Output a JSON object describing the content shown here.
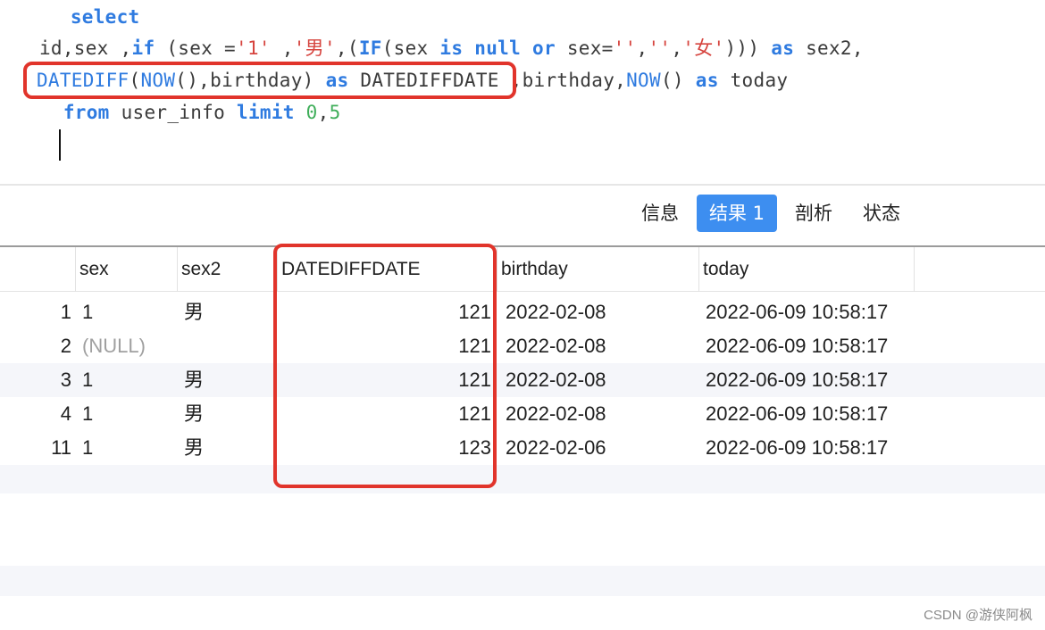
{
  "editor": {
    "line1": {
      "indent": "   ",
      "kw_select": "select"
    },
    "line2": {
      "t1": " id,sex ,",
      "kw_if": "if",
      "t2": " (sex =",
      "s1": "'1'",
      "t3": " ,",
      "s2": "'男'",
      "t4": ",(",
      "kw_IF": "IF",
      "t5": "(sex ",
      "kw_is": "is",
      "t6": " ",
      "kw_null": "null",
      "t7": " ",
      "kw_or": "or",
      "t8": " sex=",
      "s3": "''",
      "t9": ",",
      "s4": "''",
      "t10": ",",
      "s5": "'女'",
      "t11": "))) ",
      "kw_as": "as",
      "t12": " sex2,"
    },
    "line3": {
      "t0": " ",
      "fn_datediff": "DATEDIFF",
      "t1": "(",
      "fn_now": "NOW",
      "t2": "(),birthday) ",
      "kw_as": "as",
      "t3": " DATEDIFFDATE ,birthday,",
      "fn_now2": "NOW",
      "t4": "() ",
      "kw_as2": "as",
      "t5": " today"
    },
    "line4": {
      "t0": "   ",
      "kw_from": "from",
      "t1": " user_info ",
      "kw_limit": "limit",
      "t2": " ",
      "n1": "0",
      "t3": ",",
      "n2": "5"
    }
  },
  "tabs": [
    {
      "label": "信息",
      "active": false
    },
    {
      "label": "结果 1",
      "active": true
    },
    {
      "label": "剖析",
      "active": false
    },
    {
      "label": "状态",
      "active": false
    }
  ],
  "grid": {
    "columns": [
      "sex",
      "sex2",
      "DATEDIFFDATE",
      "birthday",
      "today"
    ],
    "rows": [
      {
        "rownum": "1",
        "sex": "1",
        "sex2": "男",
        "datediffdate": "121",
        "birthday": "2022-02-08",
        "today": "2022-06-09 10:58:17"
      },
      {
        "rownum": "2",
        "sex": "(NULL)",
        "sex2": "",
        "datediffdate": "121",
        "birthday": "2022-02-08",
        "today": "2022-06-09 10:58:17"
      },
      {
        "rownum": "3",
        "sex": "1",
        "sex2": "男",
        "datediffdate": "121",
        "birthday": "2022-02-08",
        "today": "2022-06-09 10:58:17"
      },
      {
        "rownum": "4",
        "sex": "1",
        "sex2": "男",
        "datediffdate": "121",
        "birthday": "2022-02-08",
        "today": "2022-06-09 10:58:17"
      },
      {
        "rownum": "11",
        "sex": "1",
        "sex2": "男",
        "datediffdate": "123",
        "birthday": "2022-02-06",
        "today": "2022-06-09 10:58:17"
      }
    ]
  },
  "colors": {
    "keyword": "#2f7be0",
    "string": "#d6443e",
    "number": "#3fae5a",
    "highlight": "#e1342b",
    "active_tab": "#3d8ef0"
  },
  "watermark": "CSDN @游侠阿枫"
}
